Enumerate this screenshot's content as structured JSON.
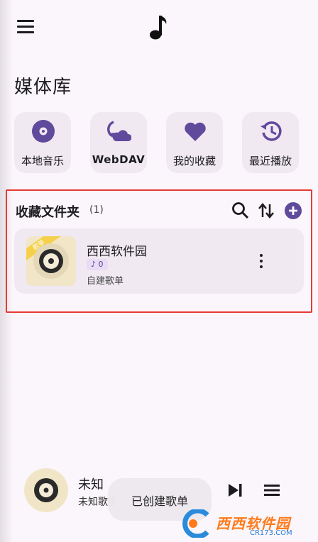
{
  "header": {
    "menu_icon": "menu-icon",
    "logo_icon": "music-note-icon"
  },
  "library": {
    "title": "媒体库",
    "quick_actions": [
      {
        "label": "本地音乐",
        "icon": "vinyl-disc-icon"
      },
      {
        "label": "WebDAV",
        "icon": "cloud-sync-icon"
      },
      {
        "label": "我的收藏",
        "icon": "heart-icon"
      },
      {
        "label": "最近播放",
        "icon": "history-icon"
      }
    ]
  },
  "favorites": {
    "title": "收藏文件夹",
    "count": "(1)",
    "tools": [
      "search-icon",
      "sort-icon",
      "add-icon"
    ],
    "items": [
      {
        "title": "西西软件园",
        "track_count": "♪ 0",
        "subtitle": "自建歌单",
        "cover_tag": "歌单"
      }
    ]
  },
  "player": {
    "title": "未知",
    "artist": "未知歌手",
    "toast": "已创建歌单"
  },
  "watermark": {
    "brand": "西西软件园",
    "site": "CR173.COM"
  },
  "colors": {
    "accent": "#5f4a9c",
    "background": "#fbf6fb",
    "card": "#f0e9f2",
    "highlight_frame": "#e53935"
  }
}
